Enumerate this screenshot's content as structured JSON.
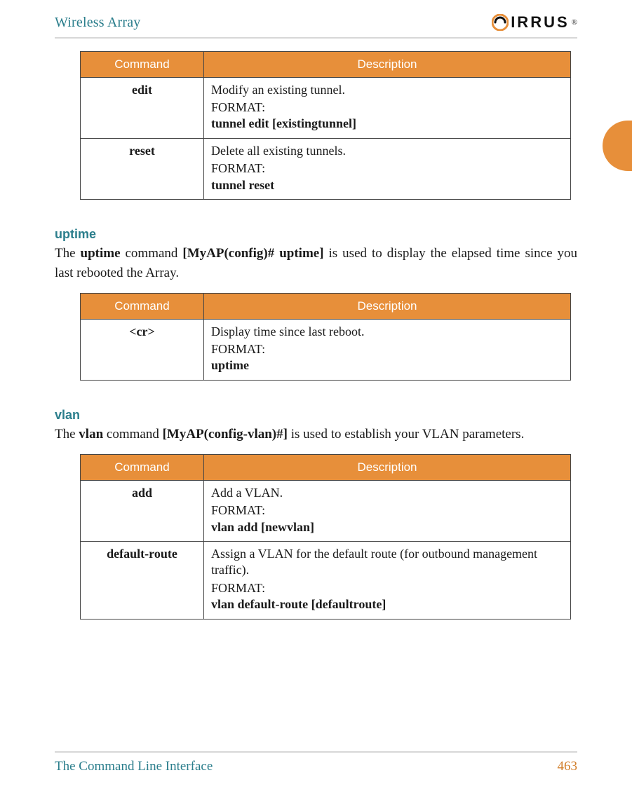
{
  "header": {
    "title": "Wireless Array",
    "logo_text": "IRRUS",
    "logo_tm": "®"
  },
  "tables": {
    "tunnel": {
      "headers": [
        "Command",
        "Description"
      ],
      "rows": [
        {
          "cmd": "edit",
          "desc": "Modify an existing tunnel.",
          "format_label": "FORMAT:",
          "format": "tunnel edit [existingtunnel]"
        },
        {
          "cmd": "reset",
          "desc": "Delete all existing tunnels.",
          "format_label": "FORMAT:",
          "format": "tunnel reset"
        }
      ]
    },
    "uptime": {
      "headers": [
        "Command",
        "Description"
      ],
      "rows": [
        {
          "cmd": "<cr>",
          "desc": "Display time since last reboot.",
          "format_label": "FORMAT:",
          "format": "uptime"
        }
      ]
    },
    "vlan": {
      "headers": [
        "Command",
        "Description"
      ],
      "rows": [
        {
          "cmd": "add",
          "desc": "Add a VLAN.",
          "format_label": "FORMAT:",
          "format": "vlan add [newvlan]"
        },
        {
          "cmd": "default-route",
          "desc": "Assign a VLAN for the default route (for outbound management traffic).",
          "format_label": "FORMAT:",
          "format": "vlan default-route [defaultroute]"
        }
      ]
    }
  },
  "sections": {
    "uptime": {
      "heading": "uptime",
      "para_pre": "The ",
      "para_b1": "uptime",
      "para_mid1": " command ",
      "para_b2": "[MyAP(config)# uptime]",
      "para_post": " is used to display the elapsed time since you last rebooted the Array."
    },
    "vlan": {
      "heading": "vlan",
      "para_pre": "The ",
      "para_b1": "vlan",
      "para_mid1": " command ",
      "para_b2": "[MyAP(config-vlan)#]",
      "para_post": " is used to establish your VLAN parameters."
    }
  },
  "footer": {
    "section": "The Command Line Interface",
    "page": "463"
  }
}
